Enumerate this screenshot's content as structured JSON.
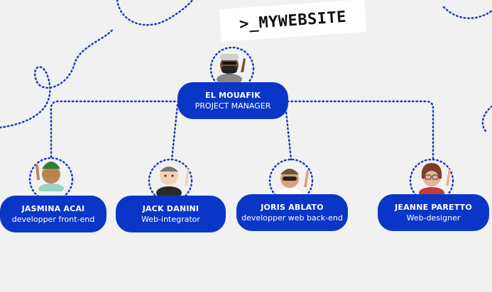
{
  "logo": {
    "text": ">_MYWEBSITE"
  },
  "manager": {
    "name": "EL MOUAFIK",
    "role": "PROJECT MANAGER"
  },
  "team": [
    {
      "name": "JASMINA ACAI",
      "role": "developper front-end"
    },
    {
      "name": "JACK DANINI",
      "role": "Web-integrator"
    },
    {
      "name": "JORIS ABLATO",
      "role": "developper web back-end"
    },
    {
      "name": "JEANNE PARETTO",
      "role": "Web-designer"
    }
  ],
  "colors": {
    "accent": "#0a36c8",
    "background": "#f1f1f1",
    "dots": "#1a3bbf"
  }
}
